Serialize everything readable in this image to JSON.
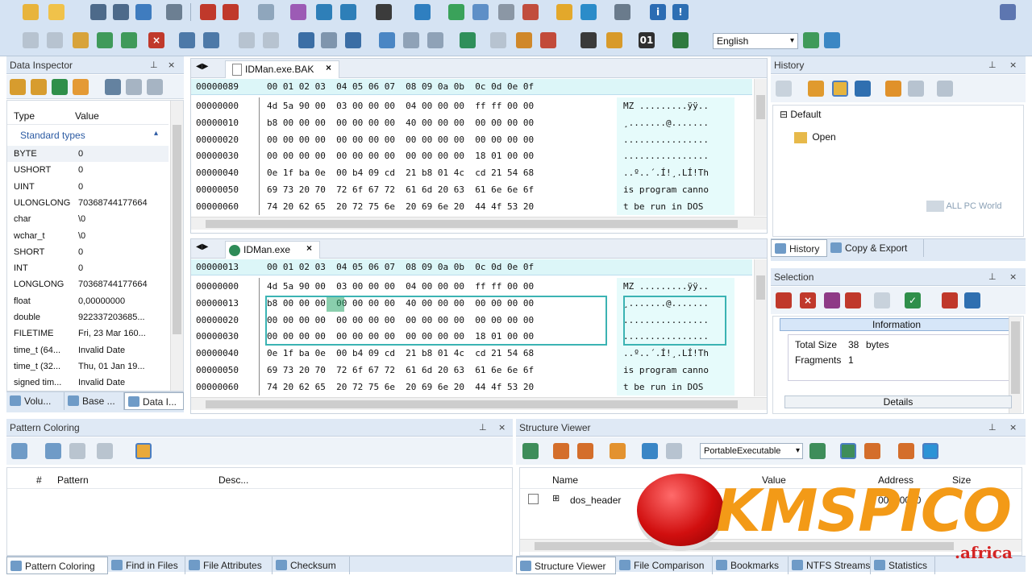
{
  "app": {
    "language": "English"
  },
  "inspector": {
    "title": "Data Inspector",
    "col_type": "Type",
    "col_value": "Value",
    "group": "Standard types",
    "rows": [
      [
        "BYTE",
        "0"
      ],
      [
        "USHORT",
        "0"
      ],
      [
        "UINT",
        "0"
      ],
      [
        "ULONGLONG",
        "70368744177664"
      ],
      [
        "char",
        "\\0"
      ],
      [
        "wchar_t",
        "\\0"
      ],
      [
        "SHORT",
        "0"
      ],
      [
        "INT",
        "0"
      ],
      [
        "LONGLONG",
        "70368744177664"
      ],
      [
        "float",
        "0,00000000"
      ],
      [
        "double",
        "922337203685..."
      ],
      [
        "FILETIME",
        "Fri, 23 Mar 160..."
      ],
      [
        "time_t (64...",
        "Invalid Date"
      ],
      [
        "time_t (32...",
        "Thu, 01 Jan 19..."
      ],
      [
        "signed tim...",
        "Invalid Date"
      ]
    ],
    "tabs": [
      "Volu...",
      "Base ...",
      "Data I..."
    ]
  },
  "hex1": {
    "tab": "IDMan.exe.BAK",
    "header_offset": "00000089",
    "header_cols": "00 01 02 03  04 05 06 07  08 09 0a 0b  0c 0d 0e 0f",
    "rows": [
      [
        "00000000",
        "4d 5a 90 00  03 00 00 00  04 00 00 00  ff ff 00 00",
        "MZ .........ÿÿ.."
      ],
      [
        "00000010",
        "b8 00 00 00  00 00 00 00  40 00 00 00  00 00 00 00",
        "¸.......@......."
      ],
      [
        "00000020",
        "00 00 00 00  00 00 00 00  00 00 00 00  00 00 00 00",
        "................"
      ],
      [
        "00000030",
        "00 00 00 00  00 00 00 00  00 00 00 00  18 01 00 00",
        "................"
      ],
      [
        "00000040",
        "0e 1f ba 0e  00 b4 09 cd  21 b8 01 4c  cd 21 54 68",
        "..º..´.Í!¸.LÍ!Th"
      ],
      [
        "00000050",
        "69 73 20 70  72 6f 67 72  61 6d 20 63  61 6e 6e 6f",
        "is program canno"
      ],
      [
        "00000060",
        "74 20 62 65  20 72 75 6e  20 69 6e 20  44 4f 53 20",
        "t be run in DOS "
      ]
    ]
  },
  "hex2": {
    "tab": "IDMan.exe",
    "header_offset": "00000013",
    "header_cols": "00 01 02 03  04 05 06 07  08 09 0a 0b  0c 0d 0e 0f",
    "rows": [
      [
        "00000000",
        "4d 5a 90 00  03 00 00 00  04 00 00 00  ff ff 00 00",
        "MZ .........ÿÿ.."
      ],
      [
        "00000013",
        "b8 00 00 00  00 00 00 00  40 00 00 00  00 00 00 00",
        "¸.......@......."
      ],
      [
        "00000020",
        "00 00 00 00  00 00 00 00  00 00 00 00  00 00 00 00",
        "................"
      ],
      [
        "00000030",
        "00 00 00 00  00 00 00 00  00 00 00 00  18 01 00 00",
        "................"
      ],
      [
        "00000040",
        "0e 1f ba 0e  00 b4 09 cd  21 b8 01 4c  cd 21 54 68",
        "..º..´.Í!¸.LÍ!Th"
      ],
      [
        "00000050",
        "69 73 20 70  72 6f 67 72  61 6d 20 63  61 6e 6e 6f",
        "is program canno"
      ],
      [
        "00000060",
        "74 20 62 65  20 72 75 6e  20 69 6e 20  44 4f 53 20",
        "t be run in DOS "
      ]
    ]
  },
  "history": {
    "title": "History",
    "root": "Default",
    "item": "Open",
    "watermark": "ALL PC World",
    "tabs": [
      "History",
      "Copy & Export"
    ]
  },
  "selection": {
    "title": "Selection",
    "info_title": "Information",
    "total_size_label": "Total Size",
    "total_size_value": "38",
    "total_size_unit": "bytes",
    "fragments_label": "Fragments",
    "fragments_value": "1",
    "details": "Details"
  },
  "pattern": {
    "title": "Pattern Coloring",
    "col_num": "#",
    "col_pattern": "Pattern",
    "col_desc": "Desc...",
    "tabs": [
      "Pattern Coloring",
      "Find in Files",
      "File Attributes",
      "Checksum"
    ]
  },
  "structure": {
    "title": "Structure Viewer",
    "template": "PortableExecutable",
    "col_name": "Name",
    "col_value": "Value",
    "col_address": "Address",
    "col_size": "Size",
    "row_name": "dos_header",
    "row_address": "00000000",
    "tabs": [
      "Structure Viewer",
      "File Comparison",
      "Bookmarks",
      "NTFS Streams",
      "Statistics"
    ]
  },
  "logo": {
    "text": "KMSPICO",
    "sub": ".africa"
  }
}
